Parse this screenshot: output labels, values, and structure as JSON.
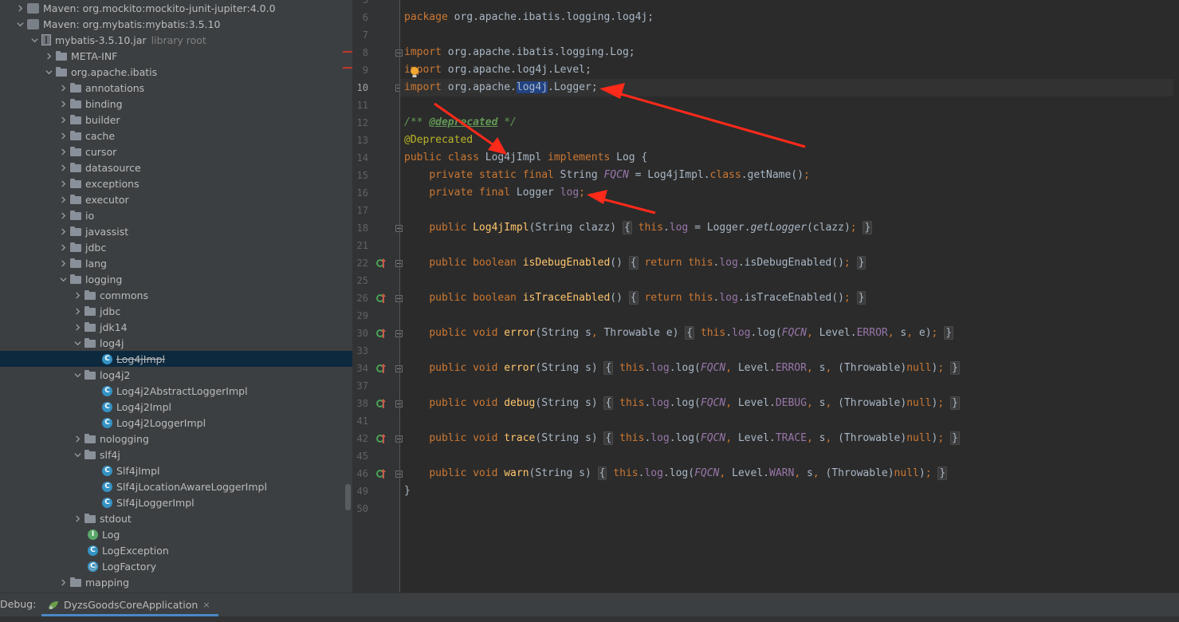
{
  "project_tree": {
    "items": [
      {
        "label": "Maven: org.mockito:mockito-junit-jupiter:4.0.0",
        "kind": "maven",
        "expanded": false
      },
      {
        "label": "Maven: org.mybatis:mybatis:3.5.10",
        "kind": "maven",
        "expanded": true
      },
      {
        "label": "mybatis-3.5.10.jar",
        "suffix": "library root",
        "kind": "jar",
        "expanded": true
      },
      {
        "label": "META-INF",
        "kind": "folder",
        "expanded": false
      },
      {
        "label": "org.apache.ibatis",
        "kind": "package",
        "expanded": true
      },
      {
        "label": "annotations",
        "kind": "package",
        "expanded": false
      },
      {
        "label": "binding",
        "kind": "package",
        "expanded": false
      },
      {
        "label": "builder",
        "kind": "package",
        "expanded": false
      },
      {
        "label": "cache",
        "kind": "package",
        "expanded": false
      },
      {
        "label": "cursor",
        "kind": "package",
        "expanded": false
      },
      {
        "label": "datasource",
        "kind": "package",
        "expanded": false
      },
      {
        "label": "exceptions",
        "kind": "package",
        "expanded": false
      },
      {
        "label": "executor",
        "kind": "package",
        "expanded": false
      },
      {
        "label": "io",
        "kind": "package",
        "expanded": false
      },
      {
        "label": "javassist",
        "kind": "package",
        "expanded": false
      },
      {
        "label": "jdbc",
        "kind": "package",
        "expanded": false
      },
      {
        "label": "lang",
        "kind": "package",
        "expanded": false
      },
      {
        "label": "logging",
        "kind": "package",
        "expanded": true
      },
      {
        "label": "commons",
        "kind": "package",
        "expanded": false
      },
      {
        "label": "jdbc",
        "kind": "package",
        "expanded": false
      },
      {
        "label": "jdk14",
        "kind": "package",
        "expanded": false
      },
      {
        "label": "log4j",
        "kind": "package",
        "expanded": true
      },
      {
        "label": "Log4jImpl",
        "kind": "class",
        "deprecated": true,
        "selected": true
      },
      {
        "label": "log4j2",
        "kind": "package",
        "expanded": true
      },
      {
        "label": "Log4j2AbstractLoggerImpl",
        "kind": "class"
      },
      {
        "label": "Log4j2Impl",
        "kind": "class"
      },
      {
        "label": "Log4j2LoggerImpl",
        "kind": "class"
      },
      {
        "label": "nologging",
        "kind": "package",
        "expanded": false
      },
      {
        "label": "slf4j",
        "kind": "package",
        "expanded": true
      },
      {
        "label": "Slf4jImpl",
        "kind": "class"
      },
      {
        "label": "Slf4jLocationAwareLoggerImpl",
        "kind": "class"
      },
      {
        "label": "Slf4jLoggerImpl",
        "kind": "class"
      },
      {
        "label": "stdout",
        "kind": "package",
        "expanded": false
      },
      {
        "label": "Log",
        "kind": "interface"
      },
      {
        "label": "LogException",
        "kind": "class"
      },
      {
        "label": "LogFactory",
        "kind": "abstract"
      },
      {
        "label": "mapping",
        "kind": "package",
        "expanded": false
      }
    ]
  },
  "editor": {
    "lines": [
      {
        "n": "5",
        "html": ""
      },
      {
        "n": "6",
        "html": "<span class='k'>package</span> org.apache.ibatis.logging.log4j;"
      },
      {
        "n": "7",
        "html": ""
      },
      {
        "n": "8",
        "html": "<span class='k'>import</span> org.apache.ibatis.logging.Log;",
        "fold": true
      },
      {
        "n": "9",
        "html": "<span class='k'>import</span> org.apache.log4j.Level;"
      },
      {
        "n": "10",
        "html": "<span class='k'>import</span> org.apache.<span class='hl'>log4j</span>.Logger;",
        "fold": true,
        "current": true
      },
      {
        "n": "11",
        "html": ""
      },
      {
        "n": "12",
        "html": "<span class='cm'>/** </span><span class='cmt'>@deprecated</span><span class='cm'> */</span>"
      },
      {
        "n": "13",
        "html": "<span class='a'>@Deprecated</span>"
      },
      {
        "n": "14",
        "html": "<span class='k'>public class</span> Log4jImpl <span class='k'>implements</span> Log {"
      },
      {
        "n": "15",
        "html": "    <span class='k'>private static final</span> String <span class='fi'>FQCN</span> = Log4jImpl.<span class='k'>class</span>.getName()<span class='k'>;</span>"
      },
      {
        "n": "16",
        "html": "    <span class='k'>private final</span> Logger <span class='f'>log</span><span class='k'>;</span>"
      },
      {
        "n": "17",
        "html": ""
      },
      {
        "n": "18",
        "html": "    <span class='k'>public</span> <span class='m'>Log4jImpl</span>(String clazz) <span class='fb'>{</span> <span class='k'>this</span>.<span class='f'>log</span> = Logger.<i>getLogger</i>(clazz)<span class='k'>;</span> <span class='fb'>}</span>",
        "fold": true
      },
      {
        "n": "21",
        "html": ""
      },
      {
        "n": "22",
        "html": "    <span class='k'>public boolean</span> <span class='m'>isDebugEnabled</span>() <span class='fb'>{</span> <span class='k'>return this</span>.<span class='f'>log</span>.isDebugEnabled()<span class='k'>;</span> <span class='fb'>}</span>",
        "fold": true,
        "impl": true
      },
      {
        "n": "25",
        "html": ""
      },
      {
        "n": "26",
        "html": "    <span class='k'>public boolean</span> <span class='m'>isTraceEnabled</span>() <span class='fb'>{</span> <span class='k'>return this</span>.<span class='f'>log</span>.isTraceEnabled()<span class='k'>;</span> <span class='fb'>}</span>",
        "fold": true,
        "impl": true
      },
      {
        "n": "29",
        "html": ""
      },
      {
        "n": "30",
        "html": "    <span class='k'>public void</span> <span class='m'>error</span>(String s<span class='k'>,</span> Throwable e) <span class='fb'>{</span> <span class='k'>this</span>.<span class='f'>log</span>.log(<span class='fi'>FQCN</span><span class='k'>,</span> Level.<span class='f'>ERROR</span><span class='k'>,</span> s<span class='k'>,</span> e)<span class='k'>;</span> <span class='fb'>}</span>",
        "fold": true,
        "impl": true
      },
      {
        "n": "33",
        "html": ""
      },
      {
        "n": "34",
        "html": "    <span class='k'>public void</span> <span class='m'>error</span>(String s) <span class='fb'>{</span> <span class='k'>this</span>.<span class='f'>log</span>.log(<span class='fi'>FQCN</span><span class='k'>,</span> Level.<span class='f'>ERROR</span><span class='k'>,</span> s<span class='k'>,</span> (Throwable)<span class='k'>null</span>)<span class='k'>;</span> <span class='fb'>}</span>",
        "fold": true,
        "impl": true
      },
      {
        "n": "37",
        "html": ""
      },
      {
        "n": "38",
        "html": "    <span class='k'>public void</span> <span class='m'>debug</span>(String s) <span class='fb'>{</span> <span class='k'>this</span>.<span class='f'>log</span>.log(<span class='fi'>FQCN</span><span class='k'>,</span> Level.<span class='f'>DEBUG</span><span class='k'>,</span> s<span class='k'>,</span> (Throwable)<span class='k'>null</span>)<span class='k'>;</span> <span class='fb'>}</span>",
        "fold": true,
        "impl": true
      },
      {
        "n": "41",
        "html": ""
      },
      {
        "n": "42",
        "html": "    <span class='k'>public void</span> <span class='m'>trace</span>(String s) <span class='fb'>{</span> <span class='k'>this</span>.<span class='f'>log</span>.log(<span class='fi'>FQCN</span><span class='k'>,</span> Level.<span class='f'>TRACE</span><span class='k'>,</span> s<span class='k'>,</span> (Throwable)<span class='k'>null</span>)<span class='k'>;</span> <span class='fb'>}</span>",
        "fold": true,
        "impl": true
      },
      {
        "n": "45",
        "html": ""
      },
      {
        "n": "46",
        "html": "    <span class='k'>public void</span> <span class='m'>warn</span>(String s) <span class='fb'>{</span> <span class='k'>this</span>.<span class='f'>log</span>.log(<span class='fi'>FQCN</span><span class='k'>,</span> Level.<span class='f'>WARN</span><span class='k'>,</span> s<span class='k'>,</span> (Throwable)<span class='k'>null</span>)<span class='k'>;</span> <span class='fb'>}</span>",
        "fold": true,
        "impl": true
      },
      {
        "n": "49",
        "html": "}"
      },
      {
        "n": "50",
        "html": ""
      }
    ]
  },
  "debug_bar": {
    "label": "Debug:",
    "tab_label": "DyzsGoodsCoreApplication",
    "close_glyph": "×"
  },
  "colors": {
    "annotation_arrow": "#ff2a1a",
    "selection": "#0d293e",
    "keyword": "#cc7832",
    "method": "#ffc66d",
    "field": "#9876aa"
  }
}
